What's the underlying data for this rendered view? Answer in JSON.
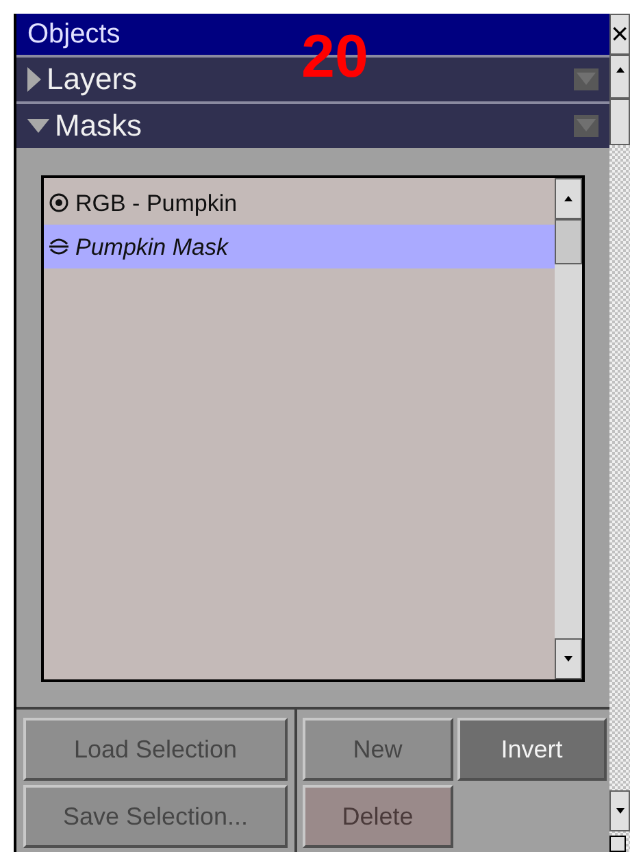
{
  "window": {
    "title": "Objects",
    "close": "×"
  },
  "badge": "20",
  "sections": [
    {
      "label": "Layers",
      "expanded": false
    },
    {
      "label": "Masks",
      "expanded": true
    }
  ],
  "masks": [
    {
      "kind": "image",
      "label": "RGB - Pumpkin",
      "selected": false
    },
    {
      "kind": "mask",
      "label": "Pumpkin Mask",
      "selected": true
    }
  ],
  "buttons": [
    {
      "label": "Load Selection",
      "disabled": true
    },
    {
      "label": "New",
      "disabled": true
    },
    {
      "label": "Invert",
      "disabled": false
    },
    {
      "label": "Save Selection...",
      "disabled": true
    },
    {
      "label": "Delete",
      "disabled": true
    }
  ]
}
